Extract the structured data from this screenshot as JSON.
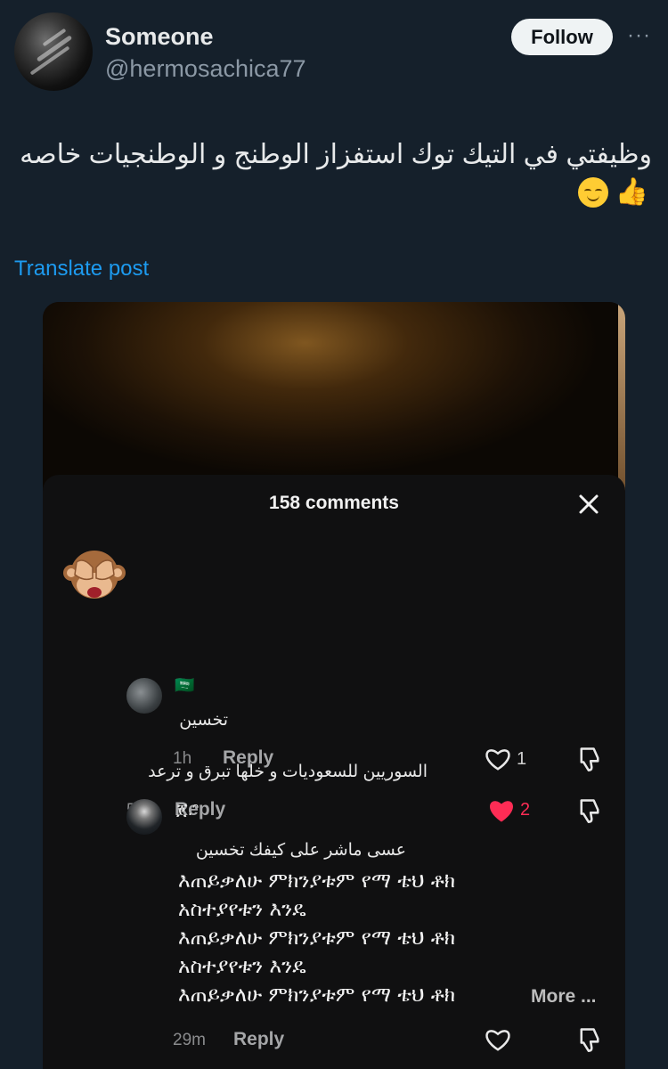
{
  "author": {
    "display_name": "Someone",
    "handle": "@hermosachica77",
    "follow_label": "Follow",
    "more_label": "···"
  },
  "post": {
    "text": "وظيفتي في التيك توك استفزاز الوطنج و الوطنجيات خاصه",
    "emoji": [
      "relieved-face",
      "thumbs-up"
    ],
    "translate_label": "Translate post"
  },
  "sheet": {
    "title": "158 comments",
    "comments": [
      {
        "avatar": "monkey-covering-eyes-emoji",
        "text": "السوريين للسعوديات و خلها تبرق و ترعد",
        "time": "5h",
        "reply_label": "Reply",
        "likes": "2",
        "liked": true
      },
      {
        "username": "🇸🇦",
        "text": "تخسين",
        "time": "1h",
        "reply_label": "Reply",
        "likes": "1",
        "liked": false
      },
      {
        "username": "ጀ.ᵔ",
        "text": "عسى ماشر على كيفك تخسين",
        "lines": [
          "እጠይቃለሁ ምክንያቱም የማ ቴህ ቶክ",
          "አስተያየቱን እንዴ",
          "እጠይቃለሁ ምክንያቱም የማ ቴህ ቶክ",
          "አስተያየቱን እንዴ",
          "እጠይቃለሁ ምክንያቱም የማ ቴህ ቶክ"
        ],
        "more_label": "More ...",
        "time": "29m",
        "reply_label": "Reply"
      }
    ]
  },
  "colors": {
    "background": "#15202b",
    "accent": "#1d9bf0",
    "like_red": "#fe2c55"
  }
}
